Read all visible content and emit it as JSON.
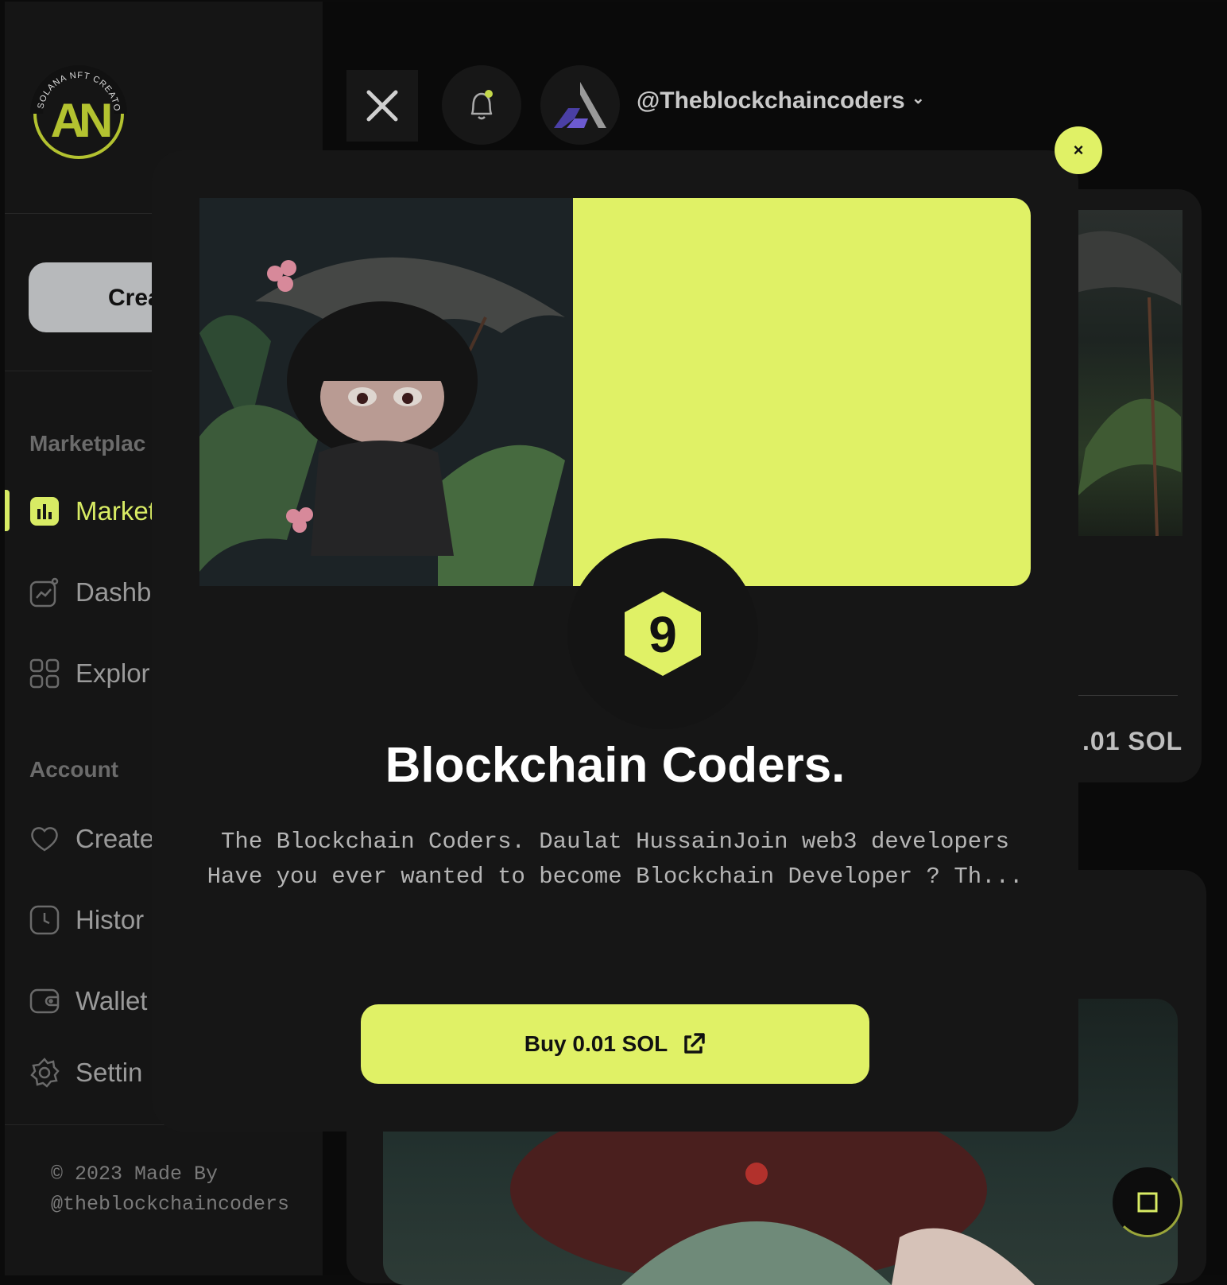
{
  "brand": {
    "logo_ring_text": "SOLANA NFT CREATOR",
    "logo_mark": "AN"
  },
  "sidebar": {
    "create_label": "Crea",
    "sections": [
      {
        "title": "Marketplac",
        "items": [
          {
            "label": "Market",
            "icon": "chart-icon",
            "active": true
          },
          {
            "label": "Dashb",
            "icon": "activity-icon"
          },
          {
            "label": "Explor",
            "icon": "grid-icon"
          }
        ]
      },
      {
        "title": "Account",
        "items": [
          {
            "label": "Create",
            "icon": "heart-icon"
          },
          {
            "label": "Histor",
            "icon": "clock-icon"
          },
          {
            "label": "Wallet",
            "icon": "wallet-icon"
          },
          {
            "label": "Settin",
            "icon": "gear-icon"
          }
        ]
      }
    ],
    "footer_line1": "© 2023 Made By",
    "footer_line2": "@theblockchaincoders"
  },
  "header": {
    "username": "@Theblockchaincoders",
    "dropdown_glyph": "⌄"
  },
  "background": {
    "card_price": ".01  SOL"
  },
  "modal": {
    "close_label": "×",
    "badge_number": "9",
    "title": "Blockchain Coders.",
    "description": "The Blockchain Coders. Daulat HussainJoin web3 developers Have you ever wanted to become Blockchain Developer ? Th...",
    "buy_label": "Buy 0.01 SOL"
  },
  "colors": {
    "accent": "#e0f166",
    "panel": "#161616",
    "bg": "#0a0a0a"
  }
}
